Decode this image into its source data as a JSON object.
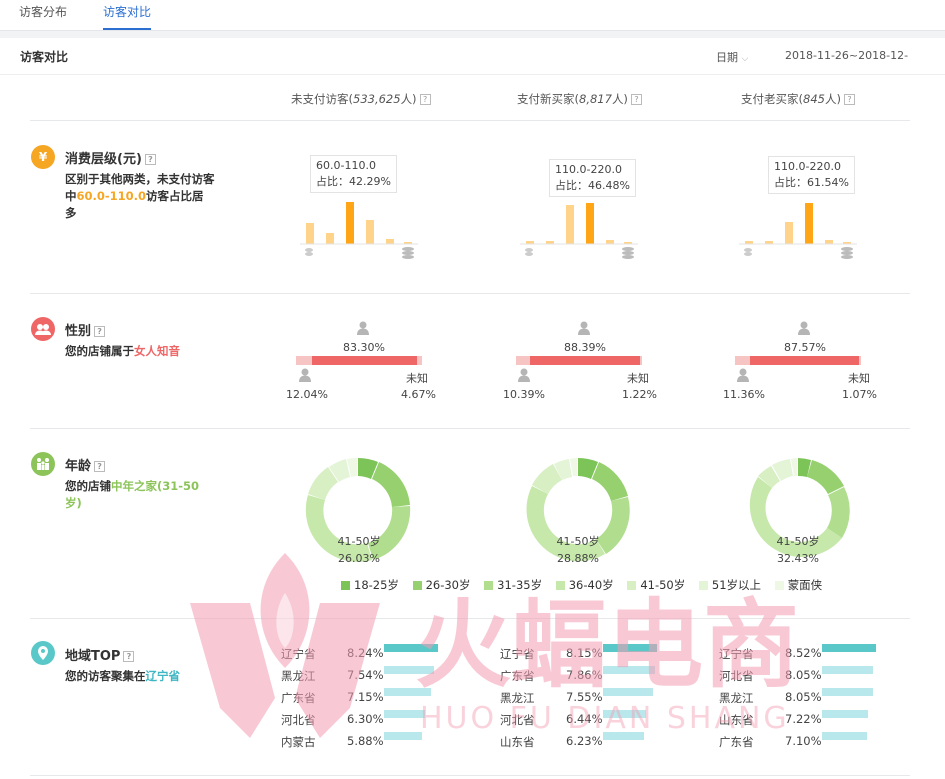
{
  "tabs": [
    {
      "label": "访客分布",
      "active": false
    },
    {
      "label": "访客对比",
      "active": true
    }
  ],
  "panel": {
    "title": "访客对比",
    "date_label": "日期",
    "date_range": "2018-11-26~2018-12-"
  },
  "columns": [
    {
      "label": "未支付访客(",
      "count": "533,625",
      "suffix": "人)"
    },
    {
      "label": "支付新买家(",
      "count": "8,817",
      "suffix": "人)"
    },
    {
      "label": "支付老买家(",
      "count": "845",
      "suffix": "人)"
    }
  ],
  "consumption": {
    "title": "消费层级(元)",
    "desc_pre": "区别于其他两类，未支付访客中",
    "desc_highlight": "60.0-110.0",
    "desc_post": "访客占比居多",
    "bubbles": [
      {
        "range": "60.0-110.0",
        "ratio": "占比：42.29%"
      },
      {
        "range": "110.0-220.0",
        "ratio": "占比：46.48%"
      },
      {
        "range": "110.0-220.0",
        "ratio": "占比：61.54%"
      }
    ],
    "highlight_color": "#ffa516",
    "base_color": "#ffd38a"
  },
  "gender": {
    "title": "性别",
    "desc_pre": "您的店铺属于",
    "desc_highlight": "女人知音",
    "unknown_label": "未知",
    "columns": [
      {
        "female": "83.30%",
        "male": "12.04%",
        "unknown": "4.67%"
      },
      {
        "female": "88.39%",
        "male": "10.39%",
        "unknown": "1.22%"
      },
      {
        "female": "87.57%",
        "male": "11.36%",
        "unknown": "1.07%"
      }
    ]
  },
  "age": {
    "title": "年龄",
    "desc_pre": "您的店铺",
    "desc_highlight": "中年之家(31-50岁)",
    "columns": [
      {
        "center_label": "41-50岁",
        "center_value": "26.03%"
      },
      {
        "center_label": "41-50岁",
        "center_value": "28.88%"
      },
      {
        "center_label": "41-50岁",
        "center_value": "32.43%"
      }
    ],
    "legend": [
      "18-25岁",
      "26-30岁",
      "31-35岁",
      "36-40岁",
      "41-50岁",
      "51岁以上",
      "蒙面侠"
    ],
    "legend_colors": [
      "#7dc458",
      "#96d06f",
      "#b0dd8e",
      "#c6e8ab",
      "#d7efc3",
      "#e4f4d6",
      "#eef8e5"
    ]
  },
  "region": {
    "title": "地域TOP",
    "desc_pre": "您的访客聚集在",
    "desc_highlight": "辽宁省",
    "columns": [
      [
        {
          "name": "辽宁省",
          "value": "8.24%"
        },
        {
          "name": "黑龙江",
          "value": "7.54%"
        },
        {
          "name": "广东省",
          "value": "7.15%"
        },
        {
          "name": "河北省",
          "value": "6.30%"
        },
        {
          "name": "内蒙古",
          "value": "5.88%"
        }
      ],
      [
        {
          "name": "辽宁省",
          "value": "8.15%"
        },
        {
          "name": "广东省",
          "value": "7.86%"
        },
        {
          "name": "黑龙江",
          "value": "7.55%"
        },
        {
          "name": "河北省",
          "value": "6.44%"
        },
        {
          "name": "山东省",
          "value": "6.23%"
        }
      ],
      [
        {
          "name": "辽宁省",
          "value": "8.52%"
        },
        {
          "name": "河北省",
          "value": "8.05%"
        },
        {
          "name": "黑龙江",
          "value": "8.05%"
        },
        {
          "name": "山东省",
          "value": "7.22%"
        },
        {
          "name": "广东省",
          "value": "7.10%"
        }
      ]
    ]
  },
  "watermark": {
    "cn": "火蝠电商",
    "en": "HUO FU DIAN SHANG"
  }
}
